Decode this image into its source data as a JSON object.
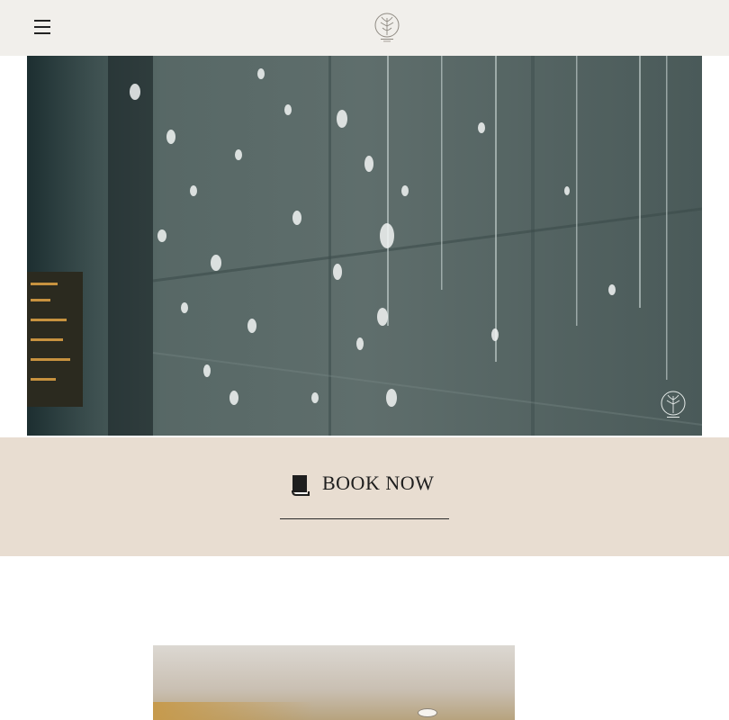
{
  "header": {
    "menu_icon": "hamburger-menu-icon",
    "logo_icon": "tree-emblem-logo"
  },
  "hero": {
    "watermark_icon": "tree-emblem-logo"
  },
  "booking": {
    "label": "BOOK NOW",
    "icon": "book-icon"
  },
  "colors": {
    "header_bg": "#f1efeb",
    "band_bg": "#e8ddd1",
    "text": "#1e1e1e"
  }
}
